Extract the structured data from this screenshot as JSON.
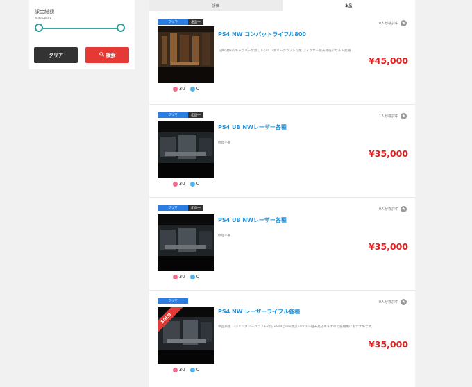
{
  "filter": {
    "title": "課金総額",
    "range_label": "Min〜Max",
    "clear_label": "クリア",
    "search_label": "検索"
  },
  "tabs": [
    {
      "label": "評価",
      "active": false
    },
    {
      "label": "出品",
      "active": true
    }
  ],
  "items": [
    {
      "type": "フリマ",
      "status": "出品中",
      "title": "PS4 NW コンバットライフル800",
      "description": "写真G数k/1キャラバーゲ無しレジェンダリークラフト可能 フィクサー銃天赫強アサルト武器",
      "price": "¥45,000",
      "watchers": "0人が検討中",
      "good": "30",
      "bad": "0",
      "sold": false
    },
    {
      "type": "フリマ",
      "status": "出品中",
      "title": "PS4 UB NWレーザー各種",
      "description": "修理不要",
      "price": "¥35,000",
      "watchers": "1人が検討中",
      "good": "30",
      "bad": "0",
      "sold": false
    },
    {
      "type": "フリマ",
      "status": "出品中",
      "title": "PS4 UB NWレーザー各種",
      "description": "修理不要",
      "price": "¥35,000",
      "watchers": "0人が検討中",
      "good": "30",
      "bad": "0",
      "sold": false
    },
    {
      "type": "フリマ",
      "status": "",
      "title": "PS4 NW レーザーライフル各種",
      "description": "単品価格 レジェンダリークラフト対応 PS/Mピone数説1000$〜越天見込めますので投機用におすすめです。",
      "price": "¥35,000",
      "watchers": "0人が検討中",
      "good": "30",
      "bad": "0",
      "sold": true,
      "sold_label": "SOLD"
    }
  ]
}
